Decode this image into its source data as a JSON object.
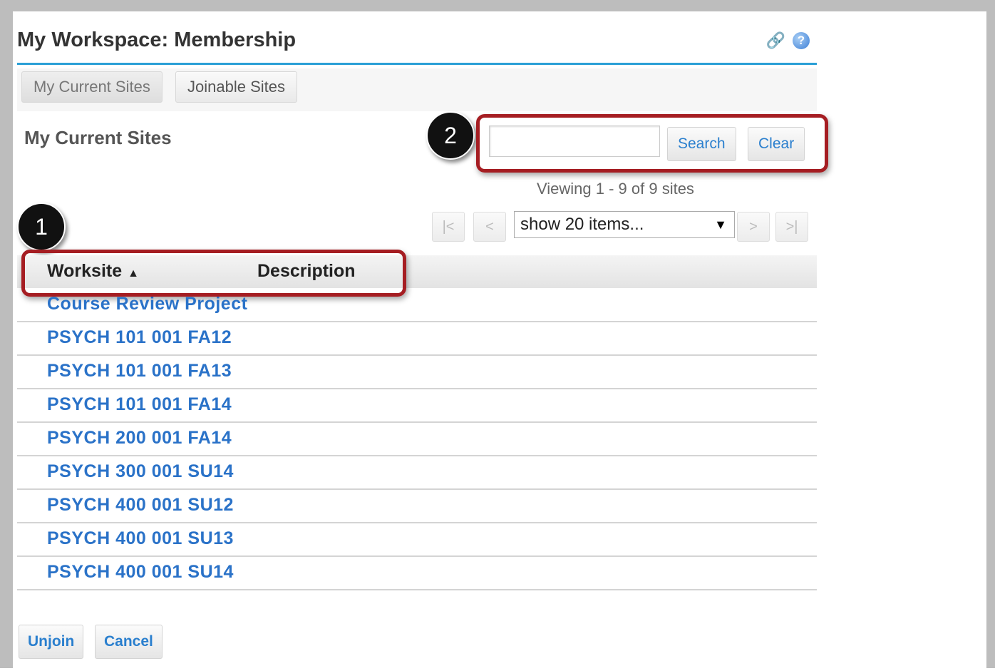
{
  "header": {
    "title": "My Workspace: Membership",
    "link_icon": "link-icon",
    "help_icon": "help-icon",
    "help_glyph": "?"
  },
  "tabs": [
    {
      "label": "My Current Sites",
      "active": true
    },
    {
      "label": "Joinable Sites",
      "active": false
    }
  ],
  "section": {
    "title": "My Current Sites"
  },
  "search": {
    "value": "",
    "placeholder": "",
    "search_label": "Search",
    "clear_label": "Clear"
  },
  "pager": {
    "viewing_text": "Viewing 1 - 9 of 9 sites",
    "first": "|<",
    "prev": "<",
    "next": ">",
    "last": ">|",
    "page_size": "show 20 items...",
    "arrow": "▼"
  },
  "table": {
    "columns": [
      "Worksite",
      "Description"
    ],
    "sort_icon": "▲",
    "rows": [
      "Course Review Project",
      "PSYCH 101 001 FA12",
      "PSYCH 101 001 FA13",
      "PSYCH 101 001 FA14",
      "PSYCH 200 001 FA14",
      "PSYCH 300 001 SU14",
      "PSYCH 400 001 SU12",
      "PSYCH 400 001 SU13",
      "PSYCH 400 001 SU14"
    ]
  },
  "footer": {
    "unjoin_label": "Unjoin",
    "cancel_label": "Cancel"
  },
  "callouts": {
    "one": "1",
    "two": "2"
  },
  "colors": {
    "accent": "#2a9fd6",
    "link": "#2a72c8",
    "highlight": "#a51d22"
  }
}
